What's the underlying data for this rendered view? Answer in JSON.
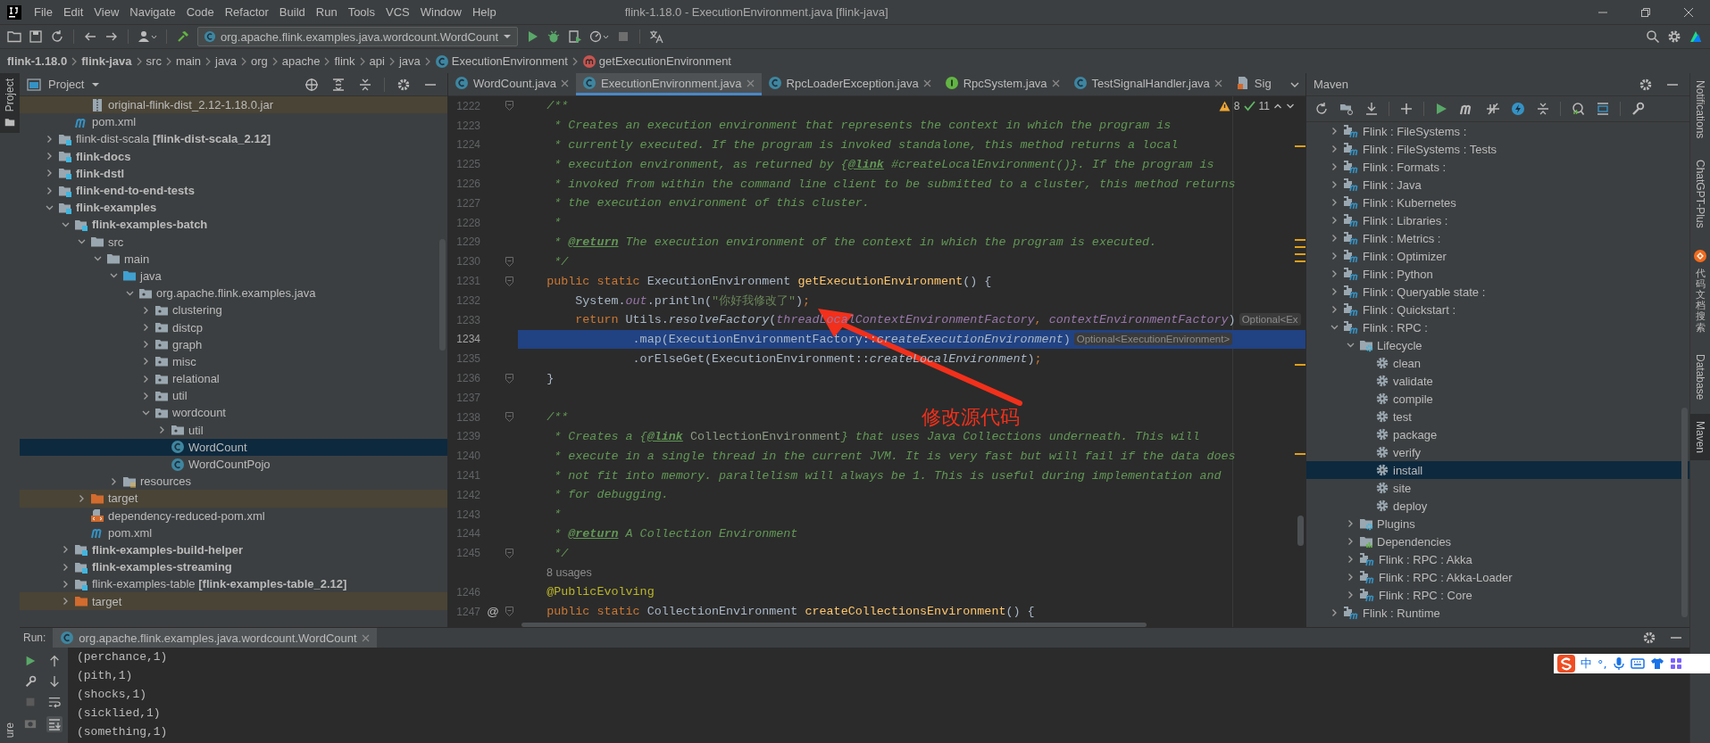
{
  "window": {
    "title": "flink-1.18.0 - ExecutionEnvironment.java [flink-java]"
  },
  "menu": [
    "File",
    "Edit",
    "View",
    "Navigate",
    "Code",
    "Refactor",
    "Build",
    "Run",
    "Tools",
    "VCS",
    "Window",
    "Help"
  ],
  "toolbar": {
    "run_configuration": "org.apache.flink.examples.java.wordcount.WordCount"
  },
  "breadcrumb": [
    {
      "label": "flink-1.18.0",
      "kind": "project"
    },
    {
      "label": "flink-java",
      "kind": "project"
    },
    {
      "label": "src",
      "kind": "folder"
    },
    {
      "label": "main",
      "kind": "folder"
    },
    {
      "label": "java",
      "kind": "folder"
    },
    {
      "label": "org",
      "kind": "folder"
    },
    {
      "label": "apache",
      "kind": "folder"
    },
    {
      "label": "flink",
      "kind": "folder"
    },
    {
      "label": "api",
      "kind": "folder"
    },
    {
      "label": "java",
      "kind": "folder"
    },
    {
      "label": "ExecutionEnvironment",
      "kind": "class"
    },
    {
      "label": "getExecutionEnvironment",
      "kind": "method"
    }
  ],
  "left_stripe": [
    {
      "label": "Project",
      "selected": true
    },
    {
      "label": "ure",
      "selected": false
    }
  ],
  "project_panel": {
    "title": "Project",
    "continued": [
      {
        "label": "original-flink-dist_2.12-1.18.0.jar",
        "kind": "jar",
        "excluded": true,
        "selected": false
      },
      {
        "label": "pom.xml",
        "kind": "pom",
        "excluded": false,
        "selected": false
      }
    ],
    "items": [
      {
        "label": "flink-dist-scala **[flink-dist-scala_2.12]**",
        "kind": "module",
        "bold": false,
        "expanded": false,
        "selected": false
      },
      {
        "label": "flink-docs",
        "kind": "module",
        "bold": true,
        "expanded": false,
        "selected": false
      },
      {
        "label": "flink-dstl",
        "kind": "module",
        "bold": true,
        "expanded": false,
        "selected": false
      },
      {
        "label": "flink-end-to-end-tests",
        "kind": "module",
        "bold": true,
        "expanded": false,
        "selected": false
      },
      {
        "label": "flink-examples",
        "kind": "module",
        "bold": true,
        "expanded": true,
        "selected": false,
        "children": [
          {
            "label": "flink-examples-batch",
            "kind": "module",
            "bold": true,
            "expanded": true,
            "selected": false,
            "children": [
              {
                "label": "src",
                "kind": "folder",
                "expanded": true,
                "selected": false,
                "children": [
                  {
                    "label": "main",
                    "kind": "folder",
                    "expanded": true,
                    "selected": false,
                    "children": [
                      {
                        "label": "java",
                        "kind": "source",
                        "expanded": true,
                        "selected": false,
                        "children": [
                          {
                            "label": "org.apache.flink.examples.java",
                            "kind": "package",
                            "expanded": true,
                            "selected": false,
                            "children": [
                              {
                                "label": "clustering",
                                "kind": "package",
                                "expanded": false,
                                "selected": false
                              },
                              {
                                "label": "distcp",
                                "kind": "package",
                                "expanded": false,
                                "selected": false
                              },
                              {
                                "label": "graph",
                                "kind": "package",
                                "expanded": false,
                                "selected": false
                              },
                              {
                                "label": "misc",
                                "kind": "package",
                                "expanded": false,
                                "selected": false
                              },
                              {
                                "label": "relational",
                                "kind": "package",
                                "expanded": false,
                                "selected": false
                              },
                              {
                                "label": "util",
                                "kind": "package",
                                "expanded": false,
                                "selected": false
                              },
                              {
                                "label": "wordcount",
                                "kind": "package",
                                "expanded": true,
                                "selected": false,
                                "children": [
                                  {
                                    "label": "util",
                                    "kind": "package",
                                    "expanded": false,
                                    "selected": false
                                  },
                                  {
                                    "label": "WordCount",
                                    "kind": "class",
                                    "selected": true
                                  },
                                  {
                                    "label": "WordCountPojo",
                                    "kind": "class",
                                    "selected": false
                                  }
                                ]
                              }
                            ]
                          }
                        ]
                      },
                      {
                        "label": "resources",
                        "kind": "resources",
                        "expanded": false,
                        "selected": false
                      }
                    ]
                  }
                ]
              },
              {
                "label": "target",
                "kind": "excluded",
                "excluded": true,
                "expanded": false,
                "selected": false
              },
              {
                "label": "dependency-reduced-pom.xml",
                "kind": "xml",
                "selected": false
              },
              {
                "label": "pom.xml",
                "kind": "pom",
                "selected": false
              }
            ]
          },
          {
            "label": "flink-examples-build-helper",
            "kind": "module",
            "bold": true,
            "expanded": false,
            "selected": false
          },
          {
            "label": "flink-examples-streaming",
            "kind": "module",
            "bold": true,
            "expanded": false,
            "selected": false
          },
          {
            "label": "flink-examples-table **[flink-examples-table_2.12]**",
            "kind": "module",
            "bold": false,
            "expanded": false,
            "selected": false
          },
          {
            "label": "target",
            "kind": "excluded",
            "excluded": true,
            "expanded": false,
            "selected": false
          }
        ]
      }
    ]
  },
  "editor": {
    "tabs": [
      {
        "label": "WordCount.java",
        "kind": "class",
        "selected": false
      },
      {
        "label": "ExecutionEnvironment.java",
        "kind": "class",
        "selected": true
      },
      {
        "label": "RpcLoaderException.java",
        "kind": "class",
        "selected": false
      },
      {
        "label": "RpcSystem.java",
        "kind": "interface",
        "selected": false
      },
      {
        "label": "TestSignalHandler.java",
        "kind": "class",
        "selected": false
      },
      {
        "label": "Sig",
        "kind": "file",
        "selected": false
      }
    ],
    "warnings": "8",
    "checks": "11",
    "lines": [
      {
        "number": "1222",
        "fold": true,
        "segments": [
          {
            "text": "    /**",
            "kind": "comment"
          }
        ]
      },
      {
        "number": "1223",
        "segments": [
          {
            "text": "     * Creates an execution environment that represents the context in which the program is",
            "kind": "comment"
          }
        ]
      },
      {
        "number": "1224",
        "segments": [
          {
            "text": "     * currently executed. If the program is invoked standalone, this method returns a local",
            "kind": "comment"
          }
        ]
      },
      {
        "number": "1225",
        "segments": [
          {
            "text": "     * execution environment, as returned by {",
            "kind": "comment"
          },
          {
            "text": "@link",
            "kind": "doc-tag"
          },
          {
            "text": " #createLocalEnvironment()}. If the program is",
            "kind": "comment"
          }
        ]
      },
      {
        "number": "1226",
        "segments": [
          {
            "text": "     * invoked from within the command line client to be submitted to a cluster, this method returns",
            "kind": "comment"
          }
        ]
      },
      {
        "number": "1227",
        "segments": [
          {
            "text": "     * the execution environment of this cluster.",
            "kind": "comment"
          }
        ]
      },
      {
        "number": "1228",
        "segments": [
          {
            "text": "     *",
            "kind": "comment"
          }
        ]
      },
      {
        "number": "1229",
        "segments": [
          {
            "text": "     * ",
            "kind": "comment"
          },
          {
            "text": "@return",
            "kind": "doc-tag"
          },
          {
            "text": " The execution environment of the context in which the program is executed.",
            "kind": "comment"
          }
        ]
      },
      {
        "number": "1230",
        "fold": true,
        "segments": [
          {
            "text": "     */",
            "kind": "comment"
          }
        ]
      },
      {
        "number": "1231",
        "fold": true,
        "segments": [
          {
            "text": "    public static ",
            "kind": "keyword"
          },
          {
            "text": "ExecutionEnvironment ",
            "kind": "plain"
          },
          {
            "text": "getExecutionEnvironment",
            "kind": "method"
          },
          {
            "text": "() {",
            "kind": "plain"
          }
        ]
      },
      {
        "number": "1232",
        "segments": [
          {
            "text": "        System.",
            "kind": "plain"
          },
          {
            "text": "out",
            "kind": "field"
          },
          {
            "text": ".println(",
            "kind": "plain"
          },
          {
            "text": "\"你好我修改了\"",
            "kind": "string"
          },
          {
            "text": ")",
            "kind": "plain"
          },
          {
            "text": ";",
            "kind": "keyword"
          }
        ]
      },
      {
        "number": "1233",
        "segments": [
          {
            "text": "        return ",
            "kind": "keyword"
          },
          {
            "text": "Utils.",
            "kind": "plain"
          },
          {
            "text": "resolveFactory",
            "kind": "static"
          },
          {
            "text": "(",
            "kind": "plain"
          },
          {
            "text": "threadLocalContextEnvironmentFactory",
            "kind": "field"
          },
          {
            "text": ", ",
            "kind": "keyword"
          },
          {
            "text": "contextEnvironmentFactory",
            "kind": "field"
          },
          {
            "text": ")",
            "kind": "plain"
          },
          {
            "text": "Optional<Ex",
            "kind": "hint"
          }
        ]
      },
      {
        "number": "1234",
        "selected": true,
        "segments": [
          {
            "text": "                .map(ExecutionEnvironmentFactory::",
            "kind": "plain"
          },
          {
            "text": "createExecutionEnvironment",
            "kind": "static"
          },
          {
            "text": ")",
            "kind": "plain"
          },
          {
            "text": "Optional<ExecutionEnvironment>",
            "kind": "hint"
          }
        ]
      },
      {
        "number": "1235",
        "segments": [
          {
            "text": "                .orElseGet(ExecutionEnvironment::",
            "kind": "plain"
          },
          {
            "text": "createLocalEnvironment",
            "kind": "static"
          },
          {
            "text": ")",
            "kind": "plain"
          },
          {
            "text": ";",
            "kind": "keyword"
          }
        ]
      },
      {
        "number": "1236",
        "fold": true,
        "segments": [
          {
            "text": "    }",
            "kind": "plain"
          }
        ]
      },
      {
        "number": "1237"
      },
      {
        "number": "1238",
        "fold": true,
        "segments": [
          {
            "text": "    /**",
            "kind": "comment"
          }
        ]
      },
      {
        "number": "1239",
        "segments": [
          {
            "text": "     * Creates a {",
            "kind": "comment"
          },
          {
            "text": "@link",
            "kind": "doc-tag"
          },
          {
            "text": " CollectionEnvironment",
            "kind": "doc-ref"
          },
          {
            "text": "} that uses Java Collections underneath. This will",
            "kind": "comment"
          }
        ]
      },
      {
        "number": "1240",
        "segments": [
          {
            "text": "     * execute in a single thread in the current JVM. It is very fast but will fail if the data does",
            "kind": "comment"
          }
        ]
      },
      {
        "number": "1241",
        "segments": [
          {
            "text": "     * not fit into memory. parallelism will always be 1. This is useful during implementation and",
            "kind": "comment"
          }
        ]
      },
      {
        "number": "1242",
        "segments": [
          {
            "text": "     * for debugging.",
            "kind": "comment"
          }
        ]
      },
      {
        "number": "1243",
        "segments": [
          {
            "text": "     *",
            "kind": "comment"
          }
        ]
      },
      {
        "number": "1244",
        "segments": [
          {
            "text": "     * ",
            "kind": "comment"
          },
          {
            "text": "@return",
            "kind": "doc-tag"
          },
          {
            "text": " A Collection Environment",
            "kind": "comment"
          }
        ]
      },
      {
        "number": "1245",
        "fold": true,
        "segments": [
          {
            "text": "     */",
            "kind": "comment"
          }
        ]
      },
      {
        "usages": "8 usages"
      },
      {
        "number": "1246",
        "segments": [
          {
            "text": "    @PublicEvolving",
            "kind": "annotation"
          }
        ]
      },
      {
        "number": "1247",
        "fold": true,
        "gutter_mark": "@",
        "segments": [
          {
            "text": "    public static ",
            "kind": "keyword"
          },
          {
            "text": "CollectionEnvironment ",
            "kind": "plain"
          },
          {
            "text": "createCollectionsEnvironment",
            "kind": "method"
          },
          {
            "text": "() {",
            "kind": "plain"
          }
        ]
      }
    ],
    "annotation": "修改源代码"
  },
  "maven_panel": {
    "title": "Maven",
    "items": [
      {
        "label": "Flink : FileSystems :",
        "kind": "module",
        "expanded": false,
        "selected": false
      },
      {
        "label": "Flink : FileSystems : Tests",
        "kind": "module",
        "expanded": false,
        "selected": false
      },
      {
        "label": "Flink : Formats :",
        "kind": "module",
        "expanded": false,
        "selected": false
      },
      {
        "label": "Flink : Java",
        "kind": "module",
        "expanded": false,
        "selected": false
      },
      {
        "label": "Flink : Kubernetes",
        "kind": "module",
        "expanded": false,
        "selected": false
      },
      {
        "label": "Flink : Libraries :",
        "kind": "module",
        "expanded": false,
        "selected": false
      },
      {
        "label": "Flink : Metrics :",
        "kind": "module",
        "expanded": false,
        "selected": false
      },
      {
        "label": "Flink : Optimizer",
        "kind": "module",
        "expanded": false,
        "selected": false
      },
      {
        "label": "Flink : Python",
        "kind": "module",
        "expanded": false,
        "selected": false
      },
      {
        "label": "Flink : Queryable state :",
        "kind": "module",
        "expanded": false,
        "selected": false
      },
      {
        "label": "Flink : Quickstart :",
        "kind": "module",
        "expanded": false,
        "selected": false
      },
      {
        "label": "Flink : RPC :",
        "kind": "module",
        "expanded": true,
        "selected": false,
        "children": [
          {
            "label": "Lifecycle",
            "kind": "lifecycle",
            "expanded": true,
            "selected": false,
            "children": [
              {
                "label": "clean",
                "kind": "goal",
                "selected": false
              },
              {
                "label": "validate",
                "kind": "goal",
                "selected": false
              },
              {
                "label": "compile",
                "kind": "goal",
                "selected": false
              },
              {
                "label": "test",
                "kind": "goal",
                "selected": false
              },
              {
                "label": "package",
                "kind": "goal",
                "selected": false
              },
              {
                "label": "verify",
                "kind": "goal",
                "selected": false
              },
              {
                "label": "install",
                "kind": "goal",
                "selected": true
              },
              {
                "label": "site",
                "kind": "goal",
                "selected": false
              },
              {
                "label": "deploy",
                "kind": "goal",
                "selected": false
              }
            ]
          },
          {
            "label": "Plugins",
            "kind": "plugins",
            "expanded": false,
            "selected": false
          },
          {
            "label": "Dependencies",
            "kind": "dependencies",
            "expanded": false,
            "selected": false
          },
          {
            "label": "Flink : RPC : Akka",
            "kind": "module",
            "expanded": false,
            "selected": false
          },
          {
            "label": "Flink : RPC : Akka-Loader",
            "kind": "module",
            "expanded": false,
            "selected": false
          },
          {
            "label": "Flink : RPC : Core",
            "kind": "module",
            "expanded": false,
            "selected": false
          }
        ]
      },
      {
        "label": "Flink : Runtime",
        "kind": "module",
        "expanded": false,
        "selected": false
      }
    ]
  },
  "right_stripe": [
    {
      "label": "Notifications",
      "kind": "latin",
      "selected": false
    },
    {
      "label": "ChatGPT-Plus",
      "kind": "latin",
      "selected": false
    },
    {
      "label": "代码文档搜索",
      "kind": "cjk",
      "selected": false
    },
    {
      "label": "Database",
      "kind": "latin",
      "selected": false
    },
    {
      "label": "Maven",
      "kind": "latin",
      "selected": true
    }
  ],
  "run_panel": {
    "label": "Run:",
    "tab": "org.apache.flink.examples.java.wordcount.WordCount",
    "output": [
      "(perchance,1)",
      "(pith,1)",
      "(shocks,1)",
      "(sicklied,1)",
      "(something,1)"
    ]
  },
  "ime_toolbar": {
    "mode": "中",
    "punctuation": "°,"
  }
}
